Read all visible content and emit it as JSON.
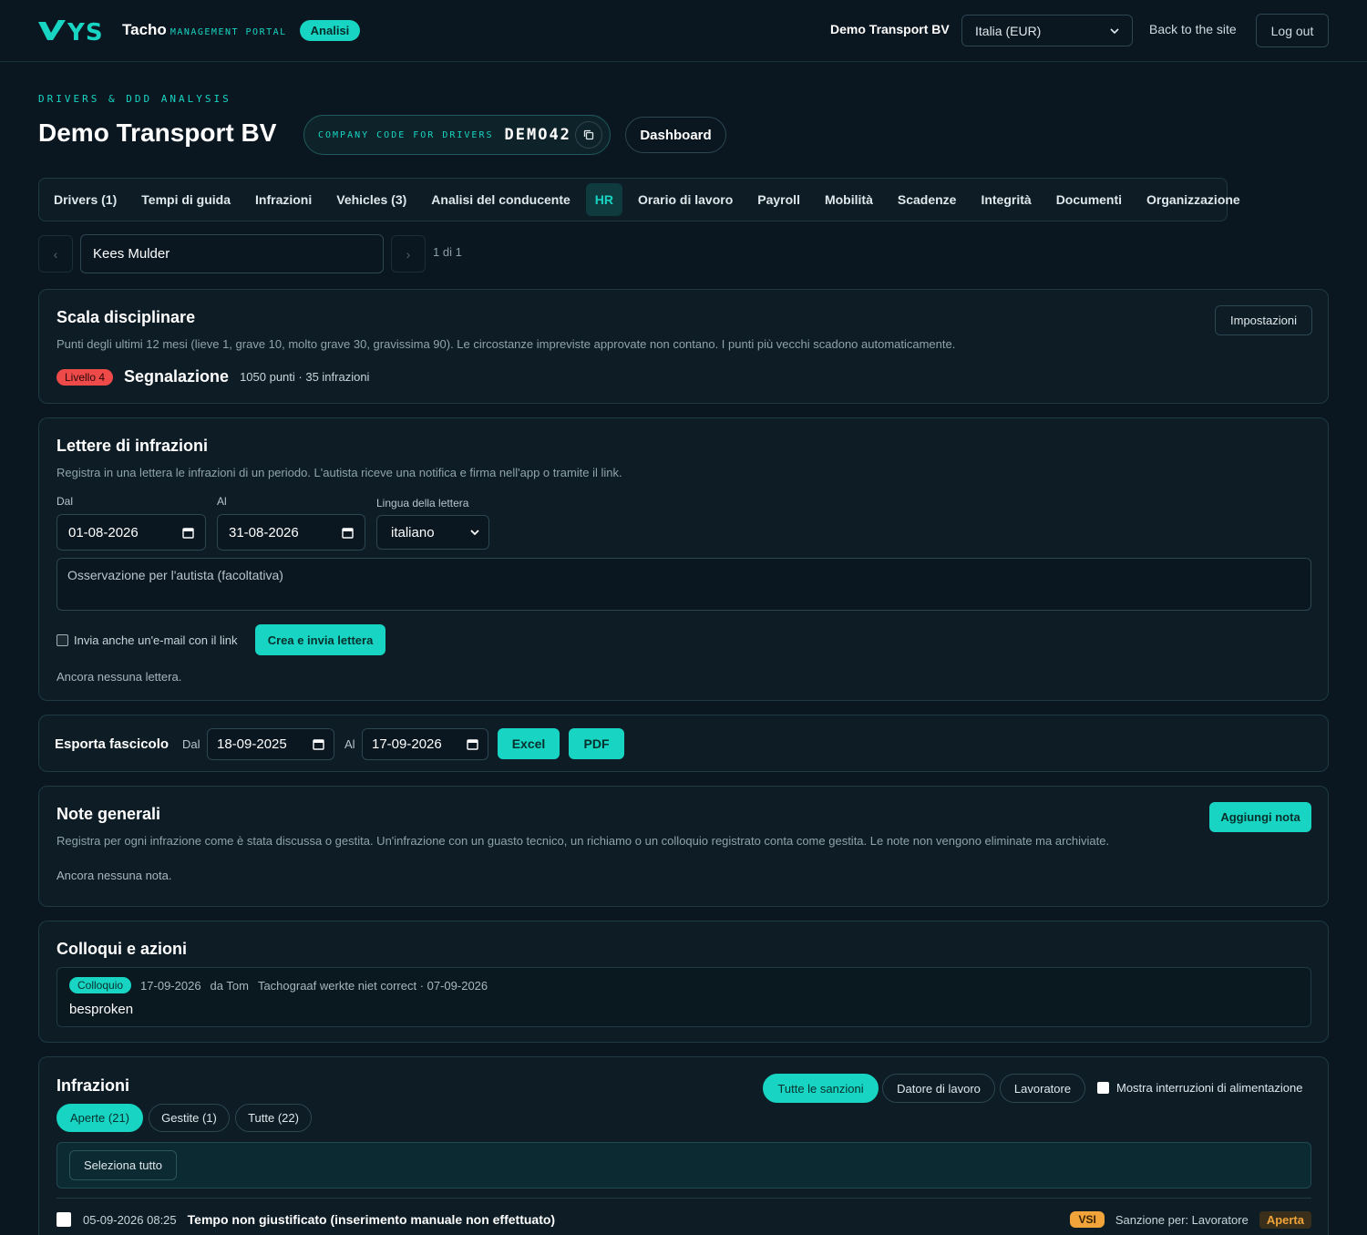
{
  "header": {
    "brand": "YS",
    "app_name": "Tacho",
    "app_sub": "MANAGEMENT PORTAL",
    "badge": "Analisi",
    "company": "Demo Transport BV",
    "region_select": "Italia (EUR)",
    "back_link": "Back to the site",
    "logout": "Log out"
  },
  "page": {
    "eyebrow": "DRIVERS & DDD ANALYSIS",
    "title": "Demo Transport BV",
    "code_label": "COMPANY CODE FOR DRIVERS",
    "code_value": "DEMO42",
    "dashboard_button": "Dashboard"
  },
  "tabs": [
    {
      "label": "Drivers (1)"
    },
    {
      "label": "Tempi di guida"
    },
    {
      "label": "Infrazioni"
    },
    {
      "label": "Vehicles (3)"
    },
    {
      "label": "Analisi del conducente"
    },
    {
      "label": "HR"
    },
    {
      "label": "Orario di lavoro"
    },
    {
      "label": "Payroll"
    },
    {
      "label": "Mobilità"
    },
    {
      "label": "Scadenze"
    },
    {
      "label": "Integrità"
    },
    {
      "label": "Documenti"
    },
    {
      "label": "Organizzazione"
    }
  ],
  "active_tab": "HR",
  "driver_nav": {
    "prev": "‹",
    "next": "›",
    "driver_name": "Kees Mulder",
    "count": "1 di 1"
  },
  "scala": {
    "title": "Scala disciplinare",
    "description": "Punti degli ultimi 12 mesi (lieve 1, grave 10, molto grave 30, gravissima 90). Le circostanze impreviste approvate non contano. I punti più vecchi scadono automaticamente.",
    "settings_button": "Impostazioni",
    "level_badge": "Livello 4",
    "level_name": "Segnalazione",
    "level_stats": "1050 punti · 35 infrazioni"
  },
  "lettere": {
    "title": "Lettere di infrazioni",
    "description": "Registra in una lettera le infrazioni di un periodo. L'autista riceve una notifica e firma nell'app o tramite il link.",
    "from_label": "Dal",
    "from_value": "01-08-2026",
    "to_label": "Al",
    "to_value": "31-08-2026",
    "lang_label": "Lingua della lettera",
    "lang_value": "italiano",
    "note_placeholder": "Osservazione per l'autista (facoltativa)",
    "email_checkbox": "Invia anche un'e-mail con il link",
    "create_button": "Crea e invia lettera",
    "empty": "Ancora nessuna lettera."
  },
  "export": {
    "title": "Esporta fascicolo",
    "from_label": "Dal",
    "from_value": "18-09-2025",
    "to_label": "Al",
    "to_value": "17-09-2026",
    "excel": "Excel",
    "pdf": "PDF"
  },
  "note": {
    "title": "Note generali",
    "description": "Registra per ogni infrazione come è stata discussa o gestita. Un'infrazione con un guasto tecnico, un richiamo o un colloquio registrato conta come gestita. Le note non vengono eliminate ma archiviate.",
    "add_button": "Aggiungi nota",
    "empty": "Ancora nessuna nota."
  },
  "colloqui": {
    "title": "Colloqui e azioni",
    "item": {
      "badge": "Colloquio",
      "date": "17-09-2026",
      "author": "da Tom",
      "subject": "Tachograaf werkte niet correct · 07-09-2026",
      "body": "besproken"
    }
  },
  "infrazioni": {
    "title": "Infrazioni",
    "filters": [
      "Tutte le sanzioni",
      "Datore di lavoro",
      "Lavoratore"
    ],
    "power_checkbox": "Mostra interruzioni di alimentazione",
    "status_tabs": [
      "Aperte (21)",
      "Gestite (1)",
      "Tutte (22)"
    ],
    "select_all": "Seleziona tutto",
    "row": {
      "datetime": "05-09-2026 08:25",
      "title": "Tempo non giustificato (inserimento manuale non effettuato)",
      "severity": "VSI",
      "sanction": "Sanzione per: Lavoratore",
      "status": "Aperta"
    }
  },
  "colors": {
    "accent": "#17d5c2",
    "background": "#0b1720",
    "card": "#0d1c25",
    "danger": "#ef4a4a",
    "warning": "#f0a43a"
  }
}
